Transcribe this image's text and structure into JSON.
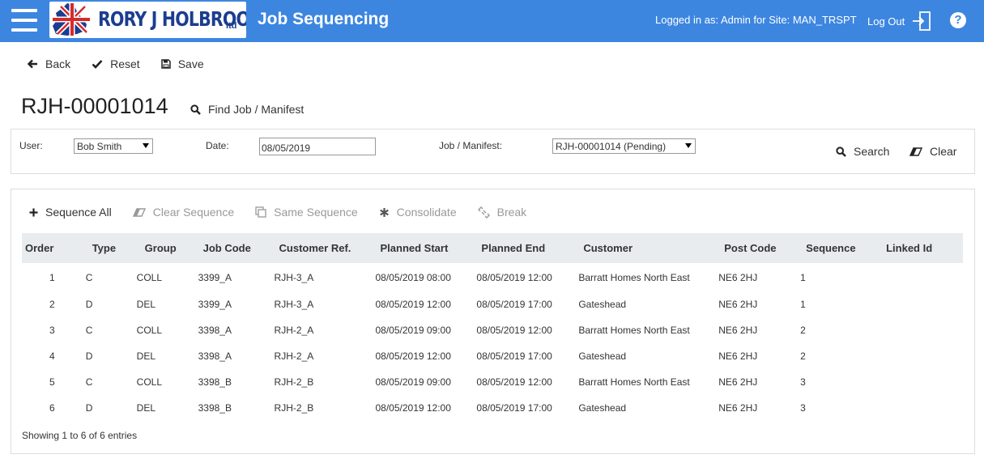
{
  "header": {
    "logo_text": "RORY J HOLBROOK",
    "logo_ltd": "ltd",
    "app_title": "Job Sequencing",
    "login_info": "Logged in as: Admin for Site: MAN_TRSPT",
    "logout_label": "Log Out",
    "help_label": "?",
    "bar_color": "#3d86e0"
  },
  "actions": {
    "back_label": "Back",
    "reset_label": "Reset",
    "save_label": "Save"
  },
  "job": {
    "title": "RJH-00001014",
    "find_label": "Find Job / Manifest"
  },
  "filter": {
    "user_label": "User:",
    "user_value": "Bob Smith",
    "date_label": "Date:",
    "date_value": "08/05/2019",
    "job_label": "Job / Manifest:",
    "job_value": "RJH-00001014 (Pending)",
    "search_label": "Search",
    "clear_label": "Clear"
  },
  "sequence_toolbar": {
    "sequence_all": "Sequence All",
    "clear_sequence": "Clear Sequence",
    "same_sequence": "Same Sequence",
    "consolidate": "Consolidate",
    "break": "Break"
  },
  "table": {
    "columns": [
      "Order",
      "Type",
      "Group",
      "Job Code",
      "Customer Ref.",
      "Planned Start",
      "Planned End",
      "Customer",
      "Post Code",
      "Sequence",
      "Linked Id"
    ],
    "rows": [
      [
        "1",
        "C",
        "COLL",
        "3399_A",
        "RJH-3_A",
        "08/05/2019 08:00",
        "08/05/2019 12:00",
        "Barratt Homes North East",
        "NE6 2HJ",
        "1",
        ""
      ],
      [
        "2",
        "D",
        "DEL",
        "3399_A",
        "RJH-3_A",
        "08/05/2019 12:00",
        "08/05/2019 17:00",
        "Gateshead",
        "NE6 2HJ",
        "1",
        ""
      ],
      [
        "3",
        "C",
        "COLL",
        "3398_A",
        "RJH-2_A",
        "08/05/2019 09:00",
        "08/05/2019 12:00",
        "Barratt Homes North East",
        "NE6 2HJ",
        "2",
        ""
      ],
      [
        "4",
        "D",
        "DEL",
        "3398_A",
        "RJH-2_A",
        "08/05/2019 12:00",
        "08/05/2019 17:00",
        "Gateshead",
        "NE6 2HJ",
        "2",
        ""
      ],
      [
        "5",
        "C",
        "COLL",
        "3398_B",
        "RJH-2_B",
        "08/05/2019 09:00",
        "08/05/2019 12:00",
        "Barratt Homes North East",
        "NE6 2HJ",
        "3",
        ""
      ],
      [
        "6",
        "D",
        "DEL",
        "3398_B",
        "RJH-2_B",
        "08/05/2019 12:00",
        "08/05/2019 17:00",
        "Gateshead",
        "NE6 2HJ",
        "3",
        ""
      ]
    ],
    "showing": "Showing 1 to 6 of 6 entries"
  }
}
